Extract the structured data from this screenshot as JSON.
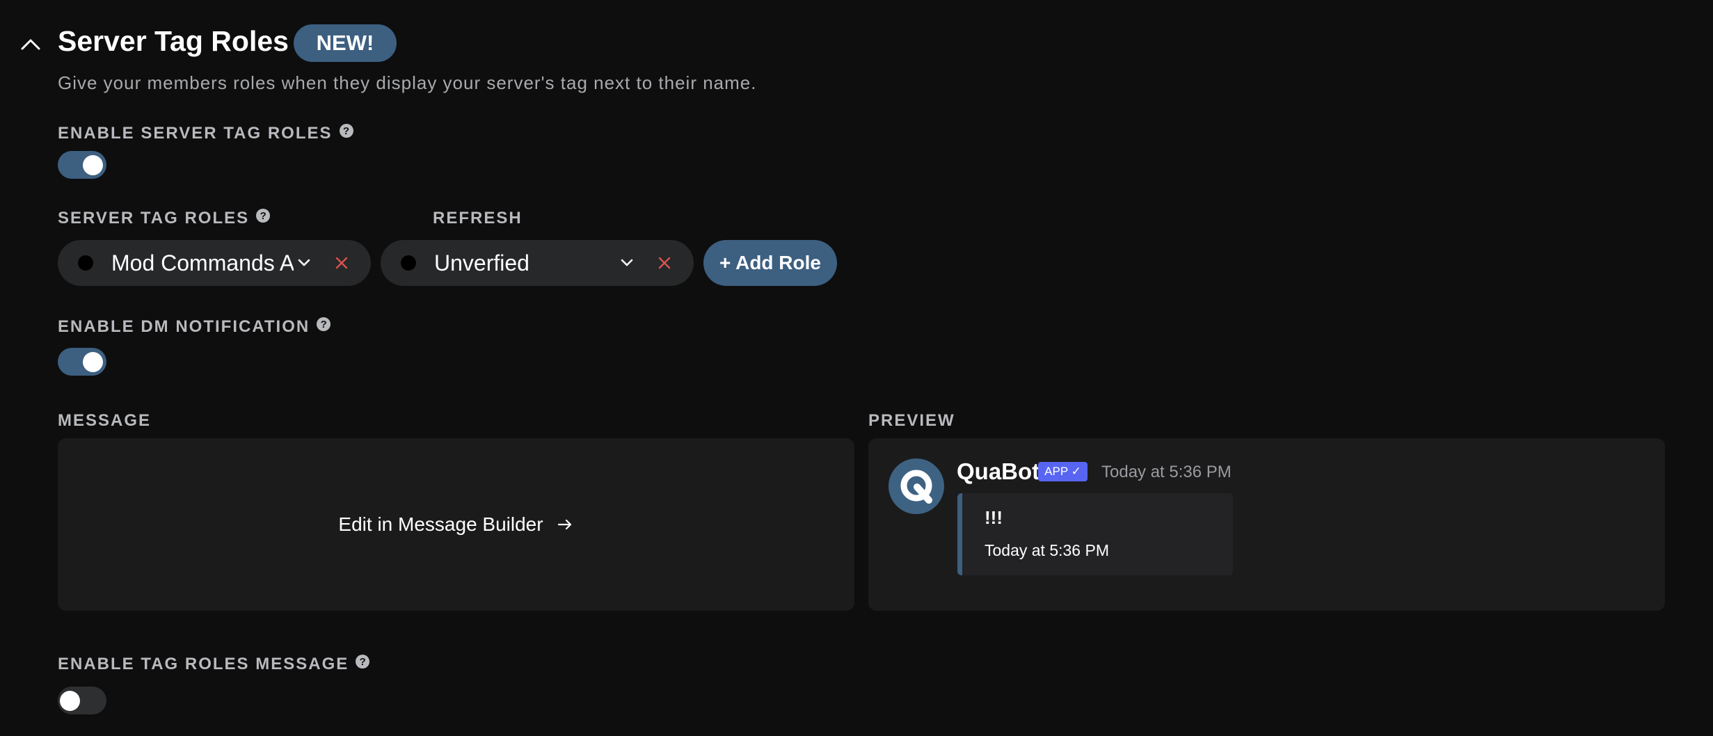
{
  "header": {
    "title": "Server Tag Roles",
    "badge": "NEW!",
    "subtitle": "Give your members roles when they display your server's tag next to their name."
  },
  "enable_server_tag_roles": {
    "label": "ENABLE SERVER TAG ROLES",
    "help": "?",
    "enabled": true
  },
  "server_tag_roles": {
    "label": "SERVER TAG ROLES",
    "help": "?",
    "refresh_label": "REFRESH",
    "roles": [
      {
        "name": "Mod Commands A"
      },
      {
        "name": "Unverfied"
      }
    ],
    "add_label": "+ Add Role"
  },
  "enable_dm_notification": {
    "label": "ENABLE DM NOTIFICATION",
    "help": "?",
    "enabled": true
  },
  "message": {
    "label": "MESSAGE",
    "edit_label": "Edit in Message Builder"
  },
  "preview": {
    "label": "PREVIEW",
    "bot_name": "QuaBot",
    "app_badge": "APP ✓",
    "timestamp": "Today at 5:36 PM",
    "embed_title": "!!!",
    "embed_footer": "Today at 5:36 PM"
  },
  "enable_tag_roles_message": {
    "label": "ENABLE TAG ROLES MESSAGE",
    "help": "?",
    "enabled": false
  },
  "colors": {
    "accent": "#3d5f80",
    "background": "#0e0e0f",
    "panel": "#1b1b1c",
    "remove": "#d9534f",
    "app_badge": "#5865f2"
  }
}
